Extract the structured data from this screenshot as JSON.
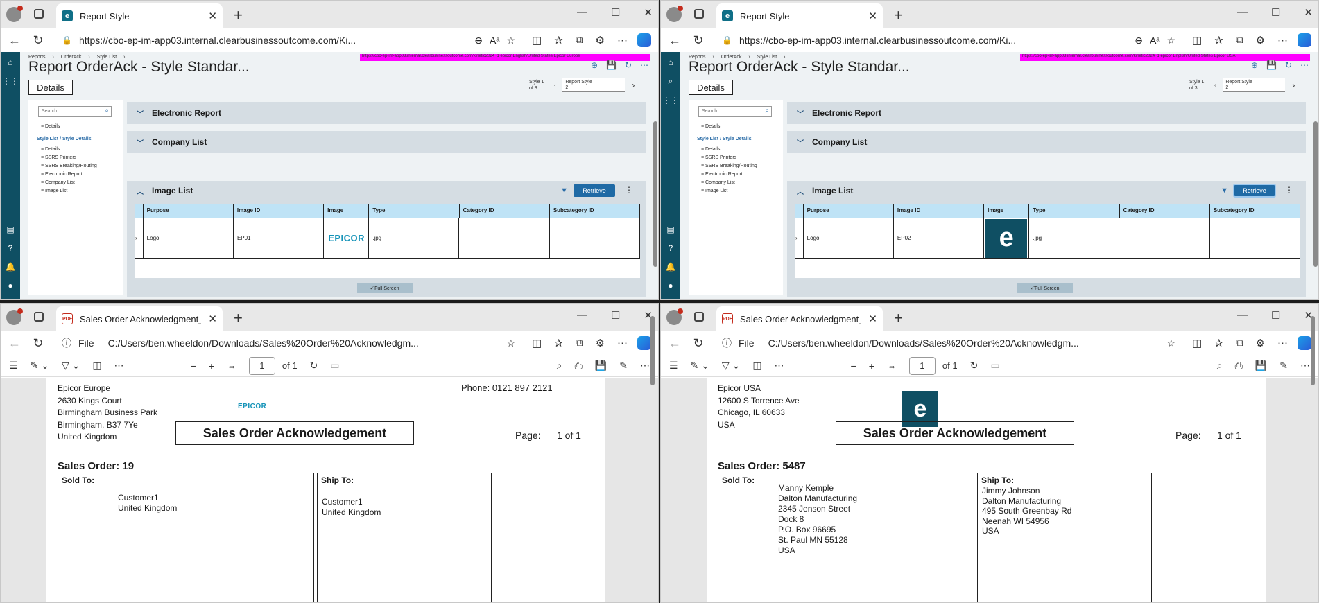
{
  "tl": {
    "tab_title": "Report Style",
    "url": "https://cbo-ep-im-app03.internal.clearbusinessoutcome.com/Ki...",
    "breadcrumb": [
      "Reports",
      "OrderAck",
      "Style List"
    ],
    "env_banner": "https://cbo-ep-im-app03.internal.clearbusinessoutcome.com/kinetic2024_1    epicor    English/United States    Epicor Europe",
    "page_title": "Report OrderAck - Style Standar...",
    "details_button": "Details",
    "style_pos": "Style 1 of 3",
    "style_select_label": "Report Style",
    "style_select_value": "2",
    "search_placeholder": "Search",
    "tree": {
      "details": "Details",
      "style_list": "Style List / Style Details",
      "items": [
        "Details",
        "SSRS Printers",
        "SSRS Breaking/Routing",
        "Electronic Report",
        "Company List",
        "Image List"
      ]
    },
    "panels": {
      "electronic": "Electronic Report",
      "company": "Company List",
      "image": "Image List"
    },
    "retrieve": "Retrieve",
    "columns": [
      "Purpose",
      "Image ID",
      "Image",
      "Type",
      "Category ID",
      "Subcategory ID"
    ],
    "row": {
      "purpose": "Logo",
      "image_id": "EP01",
      "image_text": "EPICOR",
      "type": ".jpg",
      "category": "",
      "subcategory": ""
    },
    "full_screen": "Full Screen"
  },
  "tr": {
    "tab_title": "Report Style",
    "url": "https://cbo-ep-im-app03.internal.clearbusinessoutcome.com/Ki...",
    "breadcrumb": [
      "Reports",
      "OrderAck",
      "Style List"
    ],
    "env_banner": "https://cbo-ep-im-app03.internal.clearbusinessoutcome.com/kinetic2024_1    epicor    English/United States    Epicor USA",
    "page_title": "Report OrderAck - Style Standar...",
    "details_button": "Details",
    "style_pos": "Style 1 of 3",
    "style_select_label": "Report Style",
    "style_select_value": "2",
    "search_placeholder": "Search",
    "tree": {
      "details": "Details",
      "style_list": "Style List / Style Details",
      "items": [
        "Details",
        "SSRS Printers",
        "SSRS Breaking/Routing",
        "Electronic Report",
        "Company List",
        "Image List"
      ]
    },
    "panels": {
      "electronic": "Electronic Report",
      "company": "Company List",
      "image": "Image List"
    },
    "retrieve": "Retrieve",
    "columns": [
      "Purpose",
      "Image ID",
      "Image",
      "Type",
      "Category ID",
      "Subcategory ID"
    ],
    "row": {
      "purpose": "Logo",
      "image_id": "EP02",
      "type": ".jpg",
      "category": "",
      "subcategory": ""
    },
    "full_screen": "Full Screen"
  },
  "bl": {
    "tab_title": "Sales Order Acknowledgment_42...",
    "file_label": "File",
    "url": "C:/Users/ben.wheeldon/Downloads/Sales%20Order%20Acknowledgm...",
    "page_num": "1",
    "page_of": "of 1",
    "company_lines": [
      "Epicor Europe",
      "2630 Kings Court",
      "Birmingham Business Park",
      "Birmingham,   B37 7Ye",
      "United Kingdom"
    ],
    "logo_text": "EPICOR",
    "phone": "Phone:   0121 897 2121",
    "doc_title": "Sales Order Acknowledgement",
    "page_label": "Page:",
    "page_value": "1 of 1",
    "sales_order": "Sales Order: 19",
    "sold_to_title": "Sold To:",
    "sold_to": [
      "Customer1",
      "United Kingdom"
    ],
    "ship_to_title": "Ship To:",
    "ship_to": [
      "Customer1",
      "United Kingdom"
    ]
  },
  "br": {
    "tab_title": "Sales Order Acknowledgment_42...",
    "file_label": "File",
    "url": "C:/Users/ben.wheeldon/Downloads/Sales%20Order%20Acknowledgm...",
    "page_num": "1",
    "page_of": "of 1",
    "company_lines": [
      "Epicor USA",
      "12600 S Torrence Ave",
      "Chicago, IL  60633",
      "USA"
    ],
    "doc_title": "Sales Order Acknowledgement",
    "page_label": "Page:",
    "page_value": "1 of 1",
    "sales_order": "Sales Order: 5487",
    "sold_to_title": "Sold To:",
    "sold_to": [
      "Manny Kemple",
      "Dalton Manufacturing",
      "2345 Jenson Street",
      "Dock 8",
      "P.O. Box 96695",
      "St. Paul MN 55128",
      "USA"
    ],
    "ship_to_title": "Ship To:",
    "ship_to": [
      "Jimmy Johnson",
      "Dalton Manufacturing",
      "495 South Greenbay Rd",
      "Neenah WI 54956",
      "USA"
    ]
  }
}
